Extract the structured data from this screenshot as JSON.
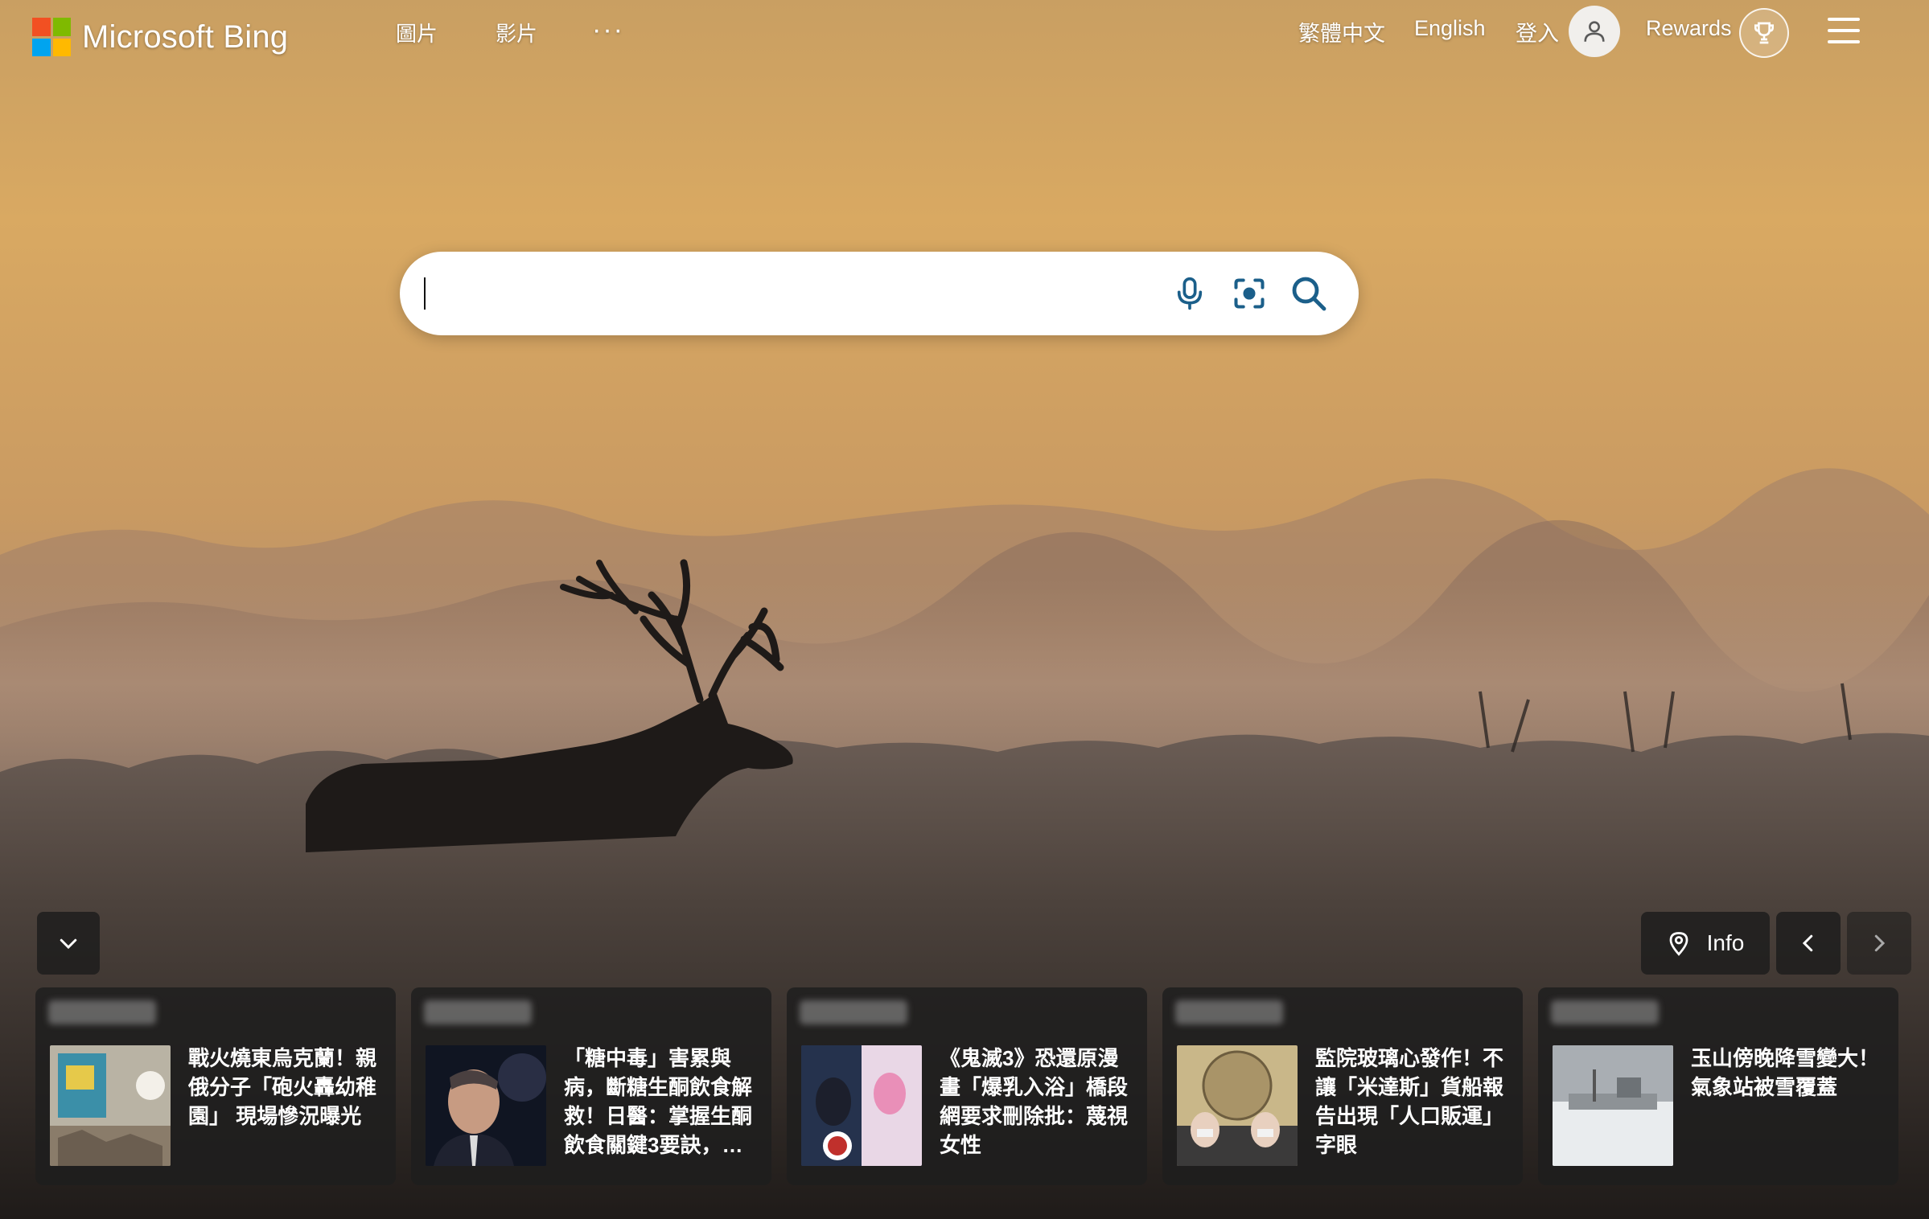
{
  "header": {
    "brand": "Microsoft Bing",
    "brand_colors": [
      "#f25022",
      "#7fba00",
      "#00a4ef",
      "#ffb900"
    ],
    "nav": [
      {
        "label": "圖片"
      },
      {
        "label": "影片"
      }
    ],
    "more": "···",
    "lang_traditional": "繁體中文",
    "lang_english": "English",
    "sign_in": "登入",
    "avatar_icon": "person-icon",
    "rewards": "Rewards",
    "rewards_icon": "trophy-icon",
    "menu_icon": "hamburger-icon"
  },
  "search": {
    "value": "",
    "placeholder": "",
    "accent": "#1b5f8a",
    "tools": [
      "microphone-icon",
      "visual-search-icon",
      "search-icon"
    ]
  },
  "controls": {
    "collapse_icon": "chevron-down-icon",
    "info_label": "Info",
    "location_icon": "location-pin-icon",
    "prev_icon": "chevron-left-icon",
    "next_icon": "chevron-right-icon"
  },
  "news": [
    {
      "title": "戰火燒東烏克蘭！親俄分子「砲火轟幼稚園」 現場慘況曝光"
    },
    {
      "title": "「糖中毒」害累與病，斷糖生酮飲食解救！日醫：掌握生酮飲食關鍵3要訣，…"
    },
    {
      "title": "《鬼滅3》恐還原漫畫「爆乳入浴」橋段　網要求刪除批：蔑視女性"
    },
    {
      "title": "監院玻璃心發作！不讓「米達斯」貨船報告出現「人口販運」字眼"
    },
    {
      "title": "玉山傍晚降雪變大！氣象站被雪覆蓋"
    }
  ]
}
